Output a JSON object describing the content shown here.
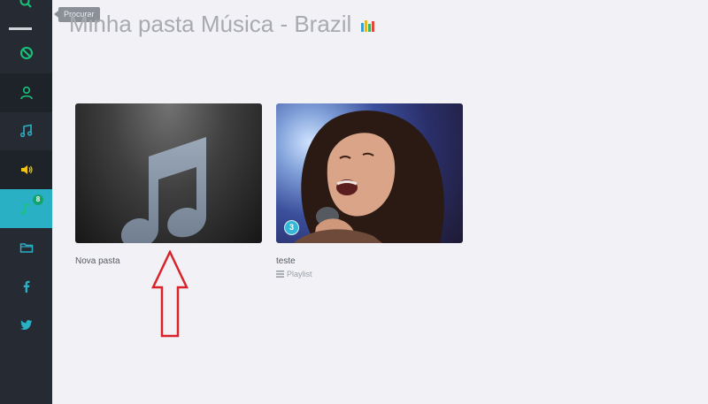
{
  "sidebar": {
    "tooltip": "Procurar",
    "badge_count": "8",
    "items": [
      {
        "icon": "search-icon"
      },
      {
        "icon": "block-icon"
      },
      {
        "icon": "user-icon"
      },
      {
        "icon": "music-note-icon"
      },
      {
        "icon": "speaker-icon"
      },
      {
        "icon": "music-note-icon",
        "active": true
      },
      {
        "icon": "folder-icon"
      },
      {
        "icon": "facebook-icon"
      },
      {
        "icon": "twitter-icon"
      }
    ]
  },
  "header": {
    "title": "Minha pasta Música - Brazil"
  },
  "cards": [
    {
      "title": "Nova pasta",
      "kind": "folder"
    },
    {
      "title": "teste",
      "subtitle": "Playlist",
      "count": "3",
      "kind": "playlist"
    }
  ],
  "colors": {
    "sidebar_bg": "#262b33",
    "active_item": "#2ab0c5",
    "green_icon": "#17c37a",
    "yellow_icon": "#f0c40f",
    "annotation_red": "#d9232a"
  }
}
